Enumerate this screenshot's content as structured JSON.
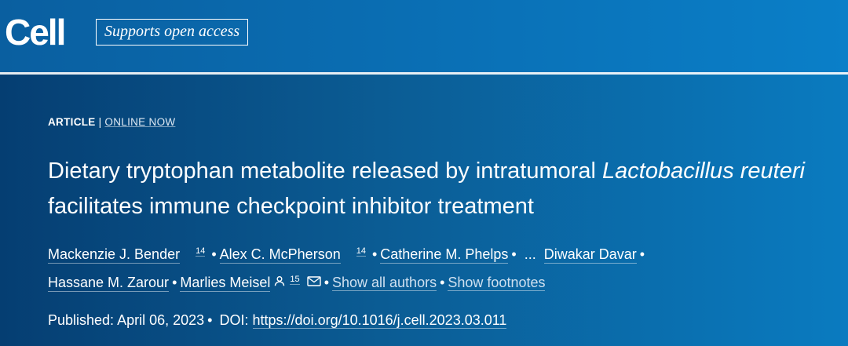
{
  "header": {
    "logo_text": "Cell",
    "open_access_label": "Supports open access"
  },
  "article_meta": {
    "type": "ARTICLE",
    "separator": "|",
    "status": "ONLINE NOW"
  },
  "title": {
    "part1": "Dietary tryptophan metabolite released by intratumoral ",
    "italic1": "Lactobacillus reuteri",
    "part2": " facilitates immune checkpoint inhibitor treatment"
  },
  "authors": {
    "list": [
      {
        "name": "Mackenzie J. Bender",
        "footnote": "14"
      },
      {
        "name": "Alex C. McPherson",
        "footnote": "14"
      },
      {
        "name": "Catherine M. Phelps"
      },
      {
        "name": "Diwakar Davar"
      },
      {
        "name": "Hassane M. Zarour"
      },
      {
        "name": "Marlies Meisel",
        "footnote": "15"
      }
    ],
    "bullet": "•",
    "ellipsis": "...",
    "show_all_label": "Show all authors",
    "show_footnotes_label": "Show footnotes"
  },
  "publication": {
    "published_label": "Published:",
    "published_date": "April 06, 2023",
    "doi_label": "DOI:",
    "doi_url": "https://doi.org/10.1016/j.cell.2023.03.011"
  },
  "icons": {
    "corresponding_author": "person-icon",
    "email": "mail-icon"
  },
  "colors": {
    "background_dark": "#053e72",
    "background_light": "#0a7bc0",
    "text": "#ffffff"
  }
}
